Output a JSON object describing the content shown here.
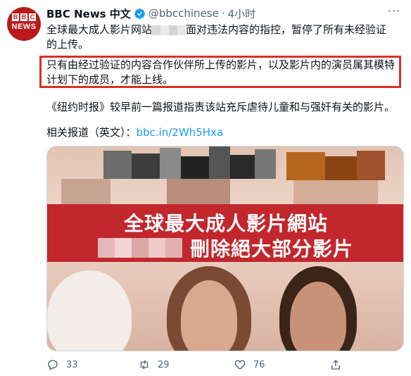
{
  "tweet": {
    "display_name": "BBC News 中文",
    "handle": "@bbcchinese",
    "time": "4小时",
    "text_line1_a": "全球最大成人影片网站",
    "text_line1_b": "面对违法内容的指控，暂停了所有未经验证",
    "text_line1_c": "的上传。",
    "highlight_text": "只有由经过验证的内容合作伙伴所上传的影片，以及影片内的演员属其模特计划下的成员，才能上线。",
    "text_line3": "《纽约时报》较早前一篇报道指责该站充斥虐待儿童和与强奸有关的影片。",
    "related_label": "相关报道（英文）：",
    "related_link": "bbc.in/2Wh5Hxa"
  },
  "avatar": {
    "bbc": [
      "B",
      "B",
      "C"
    ],
    "news": "NEWS"
  },
  "media": {
    "banner_line1": "全球最大成人影片網站",
    "banner_line2": "刪除絕大部分影片"
  },
  "actions": {
    "replies": "33",
    "retweets": "29",
    "likes": "76"
  },
  "colors": {
    "accent": "#1d9bf0",
    "bbc_red": "#bb1919",
    "banner_red": "#c1272d",
    "highlight_border": "#d93025"
  }
}
